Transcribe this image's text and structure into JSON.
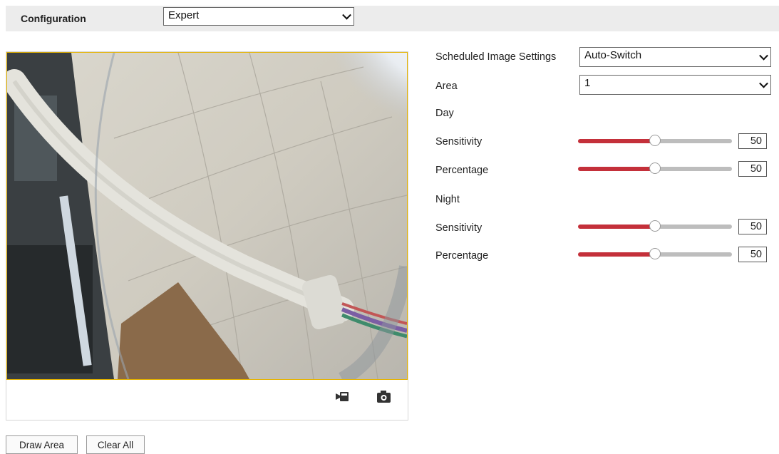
{
  "header": {
    "title": "Configuration",
    "mode_value": "Expert"
  },
  "video": {
    "record_icon": "video-record-icon",
    "snapshot_icon": "camera-snapshot-icon",
    "frame_color": "#e6b400"
  },
  "buttons": {
    "draw_area": "Draw Area",
    "clear_all": "Clear All"
  },
  "settings": {
    "scheduled_label": "Scheduled Image Settings",
    "scheduled_value": "Auto-Switch",
    "area_label": "Area",
    "area_value": "1",
    "day": {
      "heading": "Day",
      "sensitivity_label": "Sensitivity",
      "sensitivity_value": "50",
      "sensitivity_level": 0.5,
      "percentage_label": "Percentage",
      "percentage_value": "50",
      "percentage_level": 0.5
    },
    "night": {
      "heading": "Night",
      "sensitivity_label": "Sensitivity",
      "sensitivity_value": "50",
      "sensitivity_level": 0.5,
      "percentage_label": "Percentage",
      "percentage_value": "50",
      "percentage_level": 0.5
    }
  },
  "colors": {
    "slider_fill": "#c4303a",
    "slider_rest": "#bdbdbd",
    "topbar_bg": "#ececec"
  }
}
